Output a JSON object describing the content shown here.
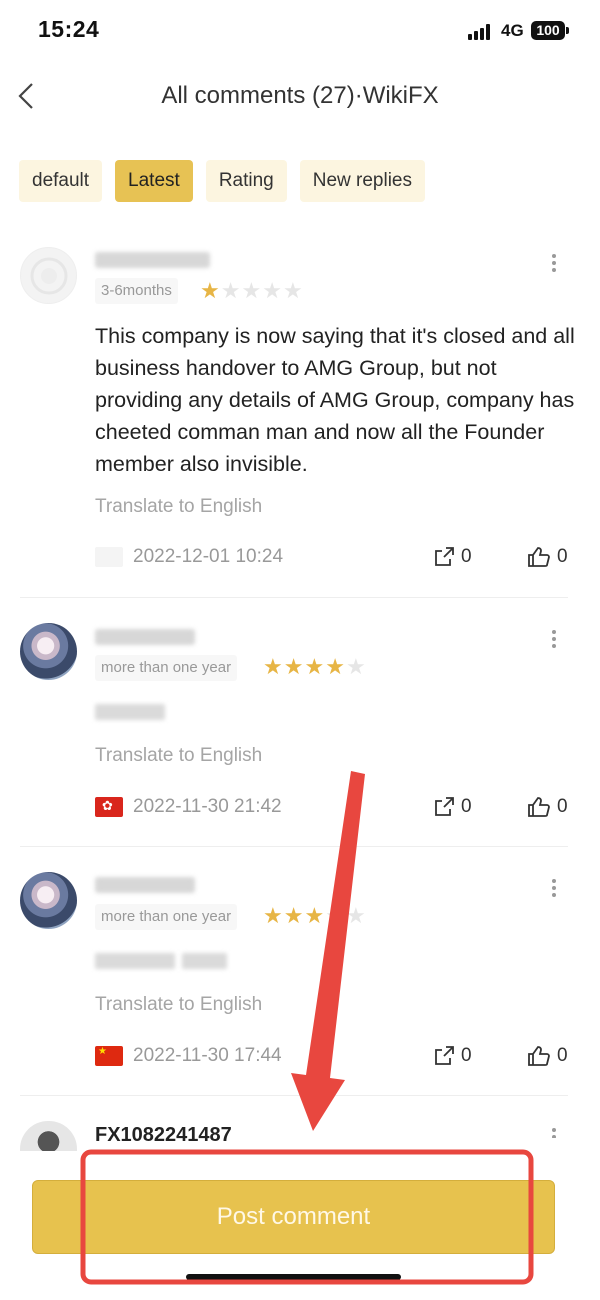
{
  "status_bar": {
    "time": "15:24",
    "network": "4G",
    "battery": "100"
  },
  "header": {
    "title": "All comments (27)·WikiFX",
    "back_icon": "chevron-left-icon"
  },
  "tabs": [
    {
      "label": "default",
      "active": false
    },
    {
      "label": "Latest",
      "active": true
    },
    {
      "label": "Rating",
      "active": false
    },
    {
      "label": "New replies",
      "active": false
    }
  ],
  "comments": [
    {
      "tenure": "3-6months",
      "rating": 1,
      "text": "This company is now saying that it's closed and all business handover to AMG Group, but not providing any details of AMG Group, company has cheeted comman man and now all the Founder member also invisible.",
      "translate": "Translate to English",
      "date": "2022-12-01 10:24",
      "shares": "0",
      "likes": "0"
    },
    {
      "tenure": "more than one year",
      "rating": 4,
      "translate": "Translate to English",
      "date": "2022-11-30 21:42",
      "shares": "0",
      "likes": "0"
    },
    {
      "tenure": "more than one year",
      "rating": 3,
      "translate": "Translate to English",
      "date": "2022-11-30 17:44",
      "shares": "0",
      "likes": "0"
    },
    {
      "username": "FX1082241487"
    }
  ],
  "footer": {
    "post_label": "Post comment"
  },
  "colors": {
    "accent": "#e7c254",
    "tab_bg": "#fcf5e0",
    "star_on": "#e7b545",
    "annotation_red": "#e8473f"
  }
}
